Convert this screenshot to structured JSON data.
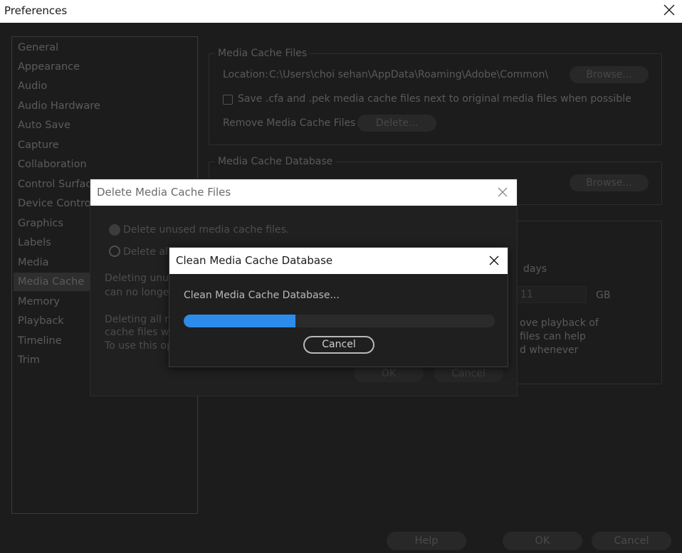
{
  "window": {
    "title": "Preferences"
  },
  "sidebar": {
    "items": [
      {
        "label": "General"
      },
      {
        "label": "Appearance"
      },
      {
        "label": "Audio"
      },
      {
        "label": "Audio Hardware"
      },
      {
        "label": "Auto Save"
      },
      {
        "label": "Capture"
      },
      {
        "label": "Collaboration"
      },
      {
        "label": "Control Surface"
      },
      {
        "label": "Device Control"
      },
      {
        "label": "Graphics"
      },
      {
        "label": "Labels"
      },
      {
        "label": "Media"
      },
      {
        "label": "Media Cache",
        "selected": true
      },
      {
        "label": "Memory"
      },
      {
        "label": "Playback"
      },
      {
        "label": "Timeline"
      },
      {
        "label": "Trim"
      }
    ]
  },
  "media_cache_files": {
    "legend": "Media Cache Files",
    "location_label": "Location:",
    "location_value": "C:\\Users\\choi sehan\\AppData\\Roaming\\Adobe\\Common\\",
    "browse_label": "Browse...",
    "save_checkbox_label": "Save .cfa and .pek media cache files next to original media files when possible",
    "save_checkbox_checked": false,
    "remove_label": "Remove Media Cache Files",
    "delete_label": "Delete..."
  },
  "media_cache_database": {
    "legend": "Media Cache Database",
    "browse_label": "Browse..."
  },
  "cache_management": {
    "days_unit": "days",
    "size_value": "11",
    "size_unit": "GB",
    "note_line1": "ove playback of",
    "note_line2": "files can help",
    "note_line3": "d whenever"
  },
  "delete_dialog": {
    "title": "Delete Media Cache Files",
    "option_unused": "Delete unused media cache files.",
    "option_all": "Delete all",
    "text1_line1": "Deleting unuse",
    "text1_line2": "can no longer b",
    "text2_line1": "Deleting all me",
    "text2_line2": "cache files will",
    "text2_line3": "To use this opt",
    "ok_label": "OK",
    "cancel_label": "Cancel"
  },
  "clean_dialog": {
    "title": "Clean Media Cache Database",
    "status": "Clean Media Cache Database...",
    "progress_fraction": 0.36,
    "cancel_label": "Cancel"
  },
  "footer": {
    "help_label": "Help",
    "ok_label": "OK",
    "cancel_label": "Cancel"
  },
  "colors": {
    "accent": "#2d8ceb",
    "background": "#1c1c1c",
    "titlebar": "#ffffff"
  }
}
